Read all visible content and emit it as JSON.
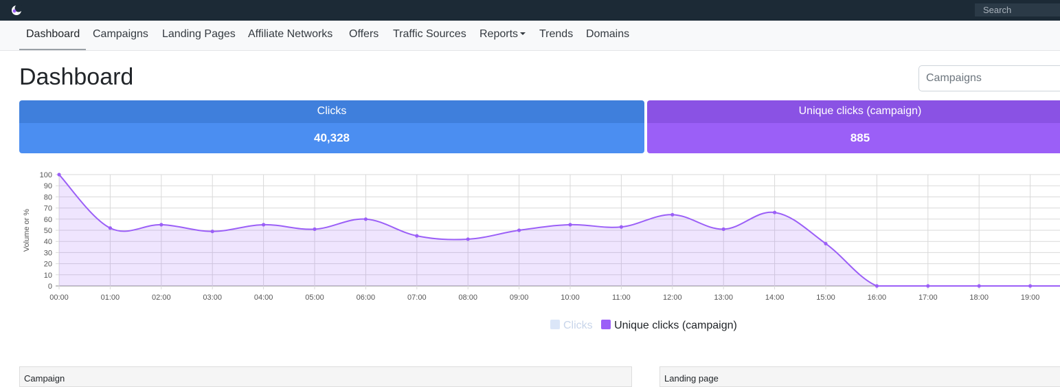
{
  "topbar": {
    "logo_icon": "moon-logo-icon",
    "search_placeholder": "Search"
  },
  "nav": {
    "items": [
      {
        "label": "Dashboard",
        "active": true
      },
      {
        "label": "Campaigns"
      },
      {
        "label": "Landing Pages"
      },
      {
        "label": "Affiliate Networks"
      },
      {
        "label": "Offers"
      },
      {
        "label": "Traffic Sources"
      },
      {
        "label": "Reports",
        "dropdown": true
      },
      {
        "label": "Trends"
      },
      {
        "label": "Domains"
      }
    ]
  },
  "page": {
    "title": "Dashboard",
    "campaign_select": "Campaigns"
  },
  "cards": {
    "clicks": {
      "label": "Clicks",
      "value": "40,328",
      "color": "#4b8ef1"
    },
    "unique": {
      "label": "Unique clicks (campaign)",
      "value": "885",
      "color": "#9b5ff7"
    }
  },
  "legend": {
    "clicks": "Clicks",
    "unique": "Unique clicks (campaign)"
  },
  "panels": {
    "campaign": "Campaign",
    "landing": "Landing page"
  },
  "chart_data": {
    "type": "area",
    "ylabel": "Volume or %",
    "xlabel": "",
    "ylim": [
      0,
      100
    ],
    "yticks": [
      0,
      10,
      20,
      30,
      40,
      50,
      60,
      70,
      80,
      90,
      100
    ],
    "x": [
      "00:00",
      "01:00",
      "02:00",
      "03:00",
      "04:00",
      "05:00",
      "06:00",
      "07:00",
      "08:00",
      "09:00",
      "10:00",
      "11:00",
      "12:00",
      "13:00",
      "14:00",
      "15:00",
      "16:00",
      "17:00",
      "18:00",
      "19:00"
    ],
    "grid": true,
    "legend_position": "bottom",
    "series": [
      {
        "name": "Clicks",
        "hidden": true,
        "color": "#dbe6f8",
        "values": []
      },
      {
        "name": "Unique clicks (campaign)",
        "color": "#9b5ff7",
        "values": [
          100,
          52,
          55,
          49,
          55,
          51,
          60,
          45,
          42,
          50,
          55,
          53,
          64,
          51,
          66,
          38,
          0,
          0,
          0,
          0
        ]
      }
    ]
  }
}
